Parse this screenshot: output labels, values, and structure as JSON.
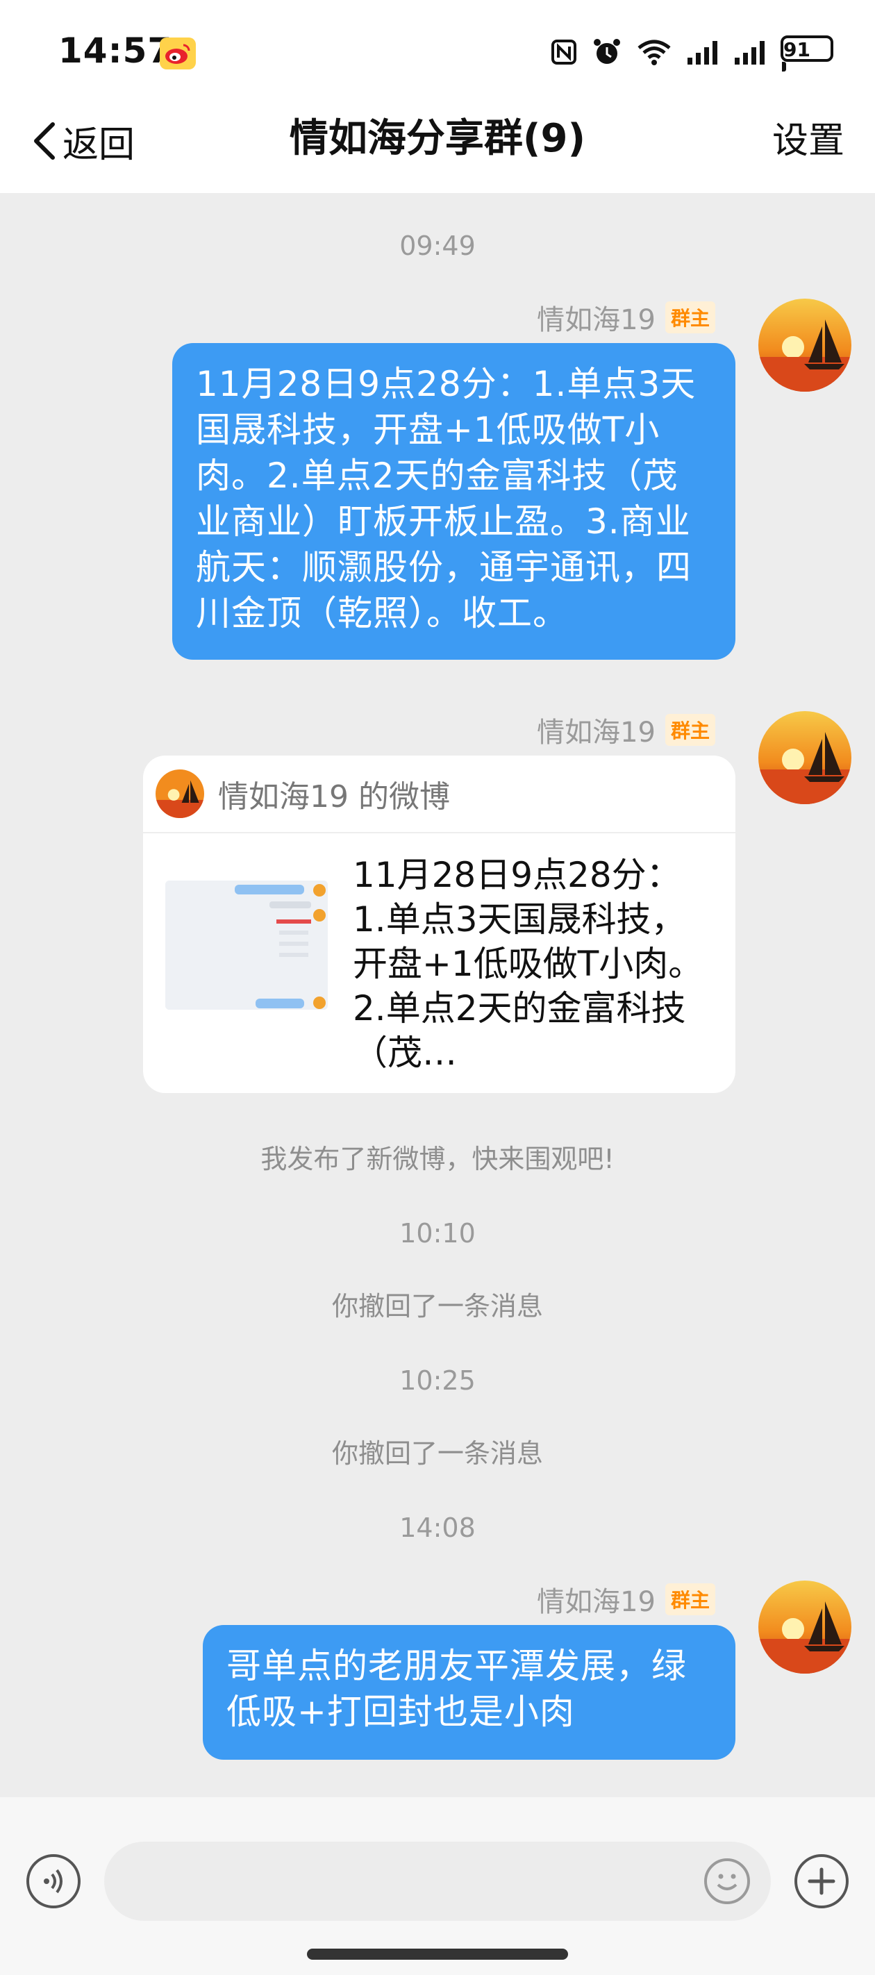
{
  "status_bar": {
    "time": "14:57",
    "battery": "91",
    "icons": [
      "nfc-icon",
      "alarm-icon",
      "wifi-icon",
      "signal-icon",
      "signal-icon",
      "battery-icon"
    ]
  },
  "nav": {
    "back_label": "返回",
    "title": "情如海分享群(9)",
    "settings_label": "设置"
  },
  "messages": {
    "t1": "09:49",
    "m1": {
      "sender": "情如海19",
      "badge": "群主",
      "text": "11月28日9点28分：1.单点3天国晟科技，开盘+1低吸做T小肉。2.单点2天的金富科技（茂业商业）盯板开板止盈。3.商业航天：顺灏股份，通宇通讯，四川金顶（乾照）。收工。"
    },
    "m2": {
      "sender": "情如海19",
      "badge": "群主",
      "card_title": "情如海19 的微博",
      "card_text": "11月28日9点28分：1.单点3天国晟科技，开盘+1低吸做T小肉。2.单点2天的金富科技（茂…"
    },
    "sys1": "我发布了新微博，快来围观吧!",
    "t2": "10:10",
    "sys2": "你撤回了一条消息",
    "t3": "10:25",
    "sys3": "你撤回了一条消息",
    "t4": "14:08",
    "m3": {
      "sender": "情如海19",
      "badge": "群主",
      "text": "哥单点的老朋友平潭发展，绿低吸+打回封也是小肉"
    }
  },
  "input": {
    "placeholder": ""
  },
  "colors": {
    "bubble": "#3d9bf3",
    "badge_text": "#ff8a00",
    "background": "#ededed"
  }
}
